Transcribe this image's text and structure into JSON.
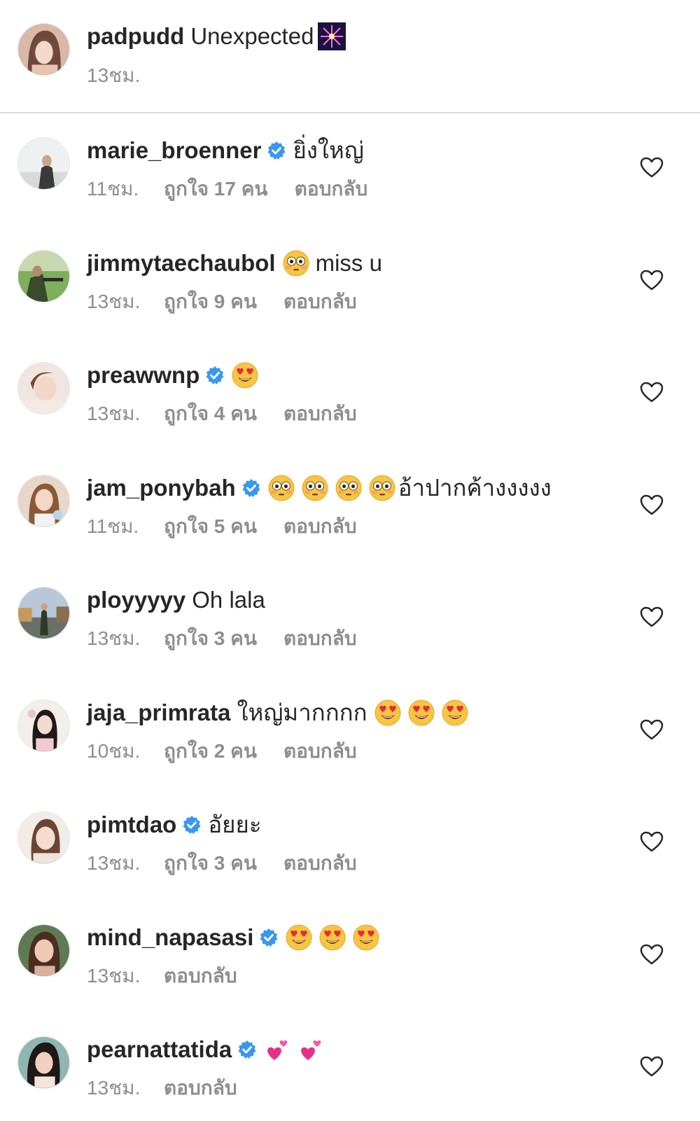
{
  "caption": {
    "username": "padpudd",
    "text": "Unexpected",
    "emoji": "firework-icon",
    "time": "13ชม."
  },
  "comments": [
    {
      "username": "marie_broenner",
      "verified": true,
      "text": "ยิ่งใหญ่",
      "emojis": [],
      "time": "11ชม.",
      "likes": "ถูกใจ 17 คน",
      "reply": "ตอบกลับ"
    },
    {
      "username": "jimmytaechaubol",
      "verified": false,
      "text": "miss u",
      "emojis": [
        "flushed-face-icon"
      ],
      "time": "13ชม.",
      "likes": "ถูกใจ 9 คน",
      "reply": "ตอบกลับ"
    },
    {
      "username": "preawwnp",
      "verified": true,
      "text": "",
      "emojis": [
        "heart-eyes-emoji-icon"
      ],
      "time": "13ชม.",
      "likes": "ถูกใจ 4 คน",
      "reply": "ตอบกลับ"
    },
    {
      "username": "jam_ponybah",
      "verified": true,
      "text": "อ้าปากค้างงงงง",
      "emojis": [
        "flushed-face-icon",
        "flushed-face-icon",
        "flushed-face-icon",
        "flushed-face-icon"
      ],
      "time": "11ชม.",
      "likes": "ถูกใจ 5 คน",
      "reply": "ตอบกลับ"
    },
    {
      "username": "ployyyyy",
      "verified": false,
      "text": "Oh lala",
      "emojis": [],
      "time": "13ชม.",
      "likes": "ถูกใจ 3 คน",
      "reply": "ตอบกลับ"
    },
    {
      "username": "jaja_primrata",
      "verified": false,
      "text": "ใหญ่มากกกก",
      "emojis": [
        "heart-eyes-emoji-icon",
        "heart-eyes-emoji-icon",
        "heart-eyes-emoji-icon"
      ],
      "time": "10ชม.",
      "likes": "ถูกใจ 2 คน",
      "reply": "ตอบกลับ"
    },
    {
      "username": "pimtdao",
      "verified": true,
      "text": "อัยยะ",
      "emojis": [],
      "time": "13ชม.",
      "likes": "ถูกใจ 3 คน",
      "reply": "ตอบกลับ"
    },
    {
      "username": "mind_napasasi",
      "verified": true,
      "text": "",
      "emojis": [
        "heart-eyes-emoji-icon",
        "heart-eyes-emoji-icon",
        "heart-eyes-emoji-icon"
      ],
      "time": "13ชม.",
      "likes": "",
      "reply": "ตอบกลับ"
    },
    {
      "username": "pearnattatida",
      "verified": true,
      "text": "",
      "emojis": [
        "two-hearts-icon",
        "two-hearts-icon"
      ],
      "time": "13ชม.",
      "likes": "",
      "reply": "ตอบกลับ"
    }
  ],
  "colors": {
    "text": "#262626",
    "secondary": "#8e8e8e",
    "verified_blue": "#3897f0",
    "divider": "#dbdbdb"
  }
}
